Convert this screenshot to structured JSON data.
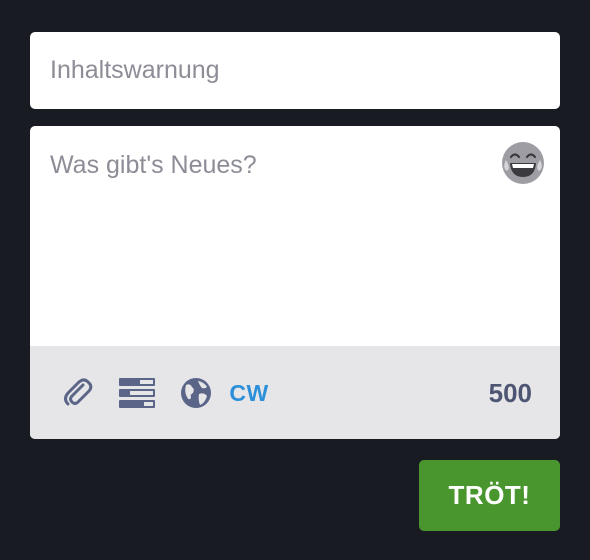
{
  "content_warning": {
    "placeholder": "Inhaltswarnung"
  },
  "composer": {
    "placeholder": "Was gibt's Neues?",
    "emoji_icon": "laughing-emoji-icon"
  },
  "toolbar": {
    "attach_icon": "paperclip-icon",
    "poll_icon": "poll-icon",
    "visibility_icon": "globe-icon",
    "cw_label": "CW",
    "char_count": "500"
  },
  "submit": {
    "label": "TRÖT!"
  },
  "colors": {
    "background": "#191b22",
    "accent_blue": "#2b90d9",
    "submit_green": "#4a962e",
    "icon_gray": "#5b6588"
  }
}
